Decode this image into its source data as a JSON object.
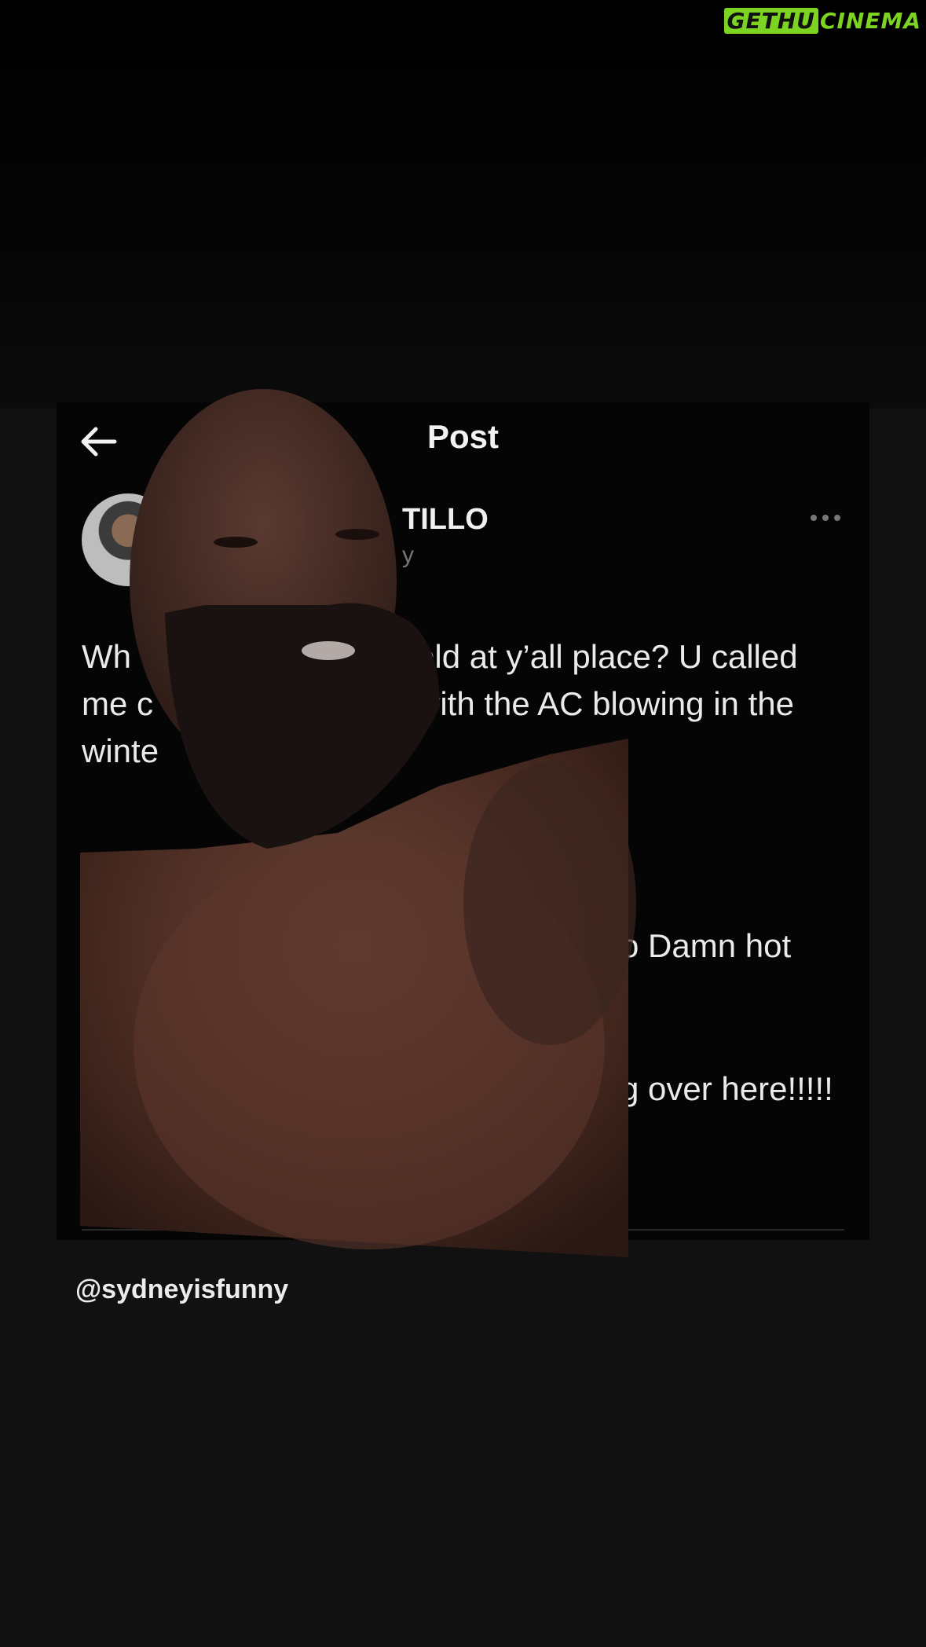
{
  "watermark": {
    "part1": "GETHU",
    "part2": "CINEMA"
  },
  "header": {
    "title": "Post",
    "back_icon": "arrow-left-icon"
  },
  "author": {
    "name_fragment": "TILLO",
    "handle_fragment": "y",
    "more_icon": "more-horizontal-icon"
  },
  "tweet": {
    "line1_start": "Wh",
    "line1_end": "old at y’all place? U called",
    "line2_start": "me c",
    "line2_end": "with the AC blowing in the",
    "line3_start": "winte",
    "line4_end": "o Damn hot",
    "line5_end": "g over here!!!!!"
  },
  "caption": {
    "handle": "@sydneyisfunny"
  },
  "colors": {
    "accent": "#7dd321",
    "background": "#111111",
    "panel": "#050505"
  }
}
